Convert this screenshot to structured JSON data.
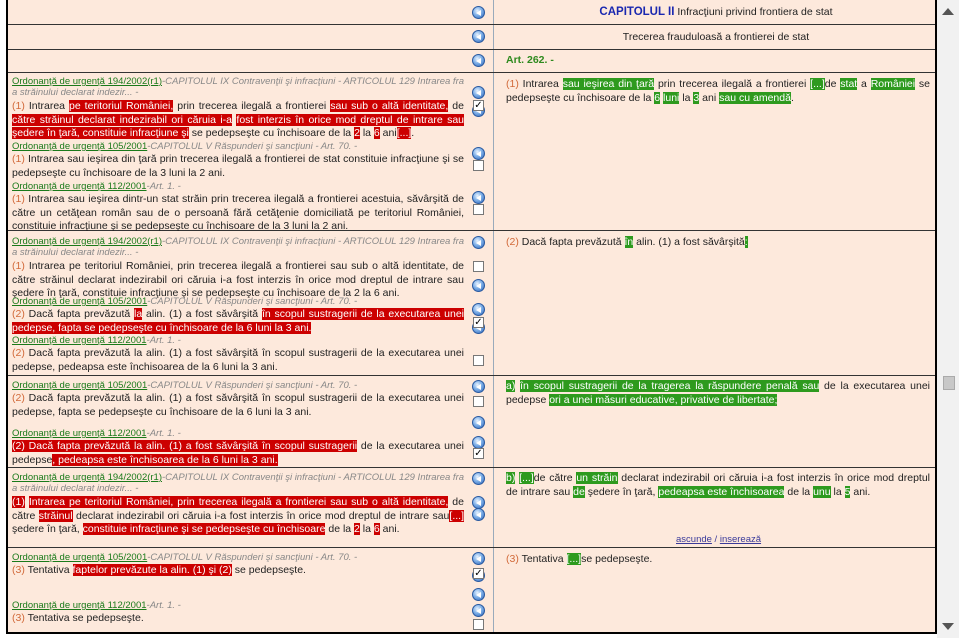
{
  "rows": [
    {
      "heading": {
        "cap": "CAPITOLUL II",
        "rest": " Infracţiuni privind frontiera de stat"
      }
    },
    {
      "heading": "Trecerea frauduloasă a frontierei de stat"
    },
    {
      "article": "Art. 262. -"
    },
    {
      "blocks": [
        {
          "link": "Ordonanţă de urgenţă 194/2002(r1)",
          "tail": "-CAPITOLUL IX Contravenţii şi infracţiuni - ARTICOLUL 129 Intrarea frauduloasă",
          "tail2": "a străinului declarat indezir... -",
          "parts": [
            {
              "t": "(1)",
              "c": "num"
            },
            {
              "t": " Intrarea "
            },
            {
              "t": "pe teritoriul României,",
              "c": "red"
            },
            {
              "t": " prin trecerea ilegală a frontierei "
            },
            {
              "t": "sau sub o altă identitate,",
              "c": "red"
            },
            {
              "t": " de "
            },
            {
              "t": "către străinul declarat indezirabil ori căruia i-a",
              "c": "red"
            },
            {
              "t": " "
            },
            {
              "t": "fost interzis în orice mod dreptul de intrare sau şedere în ţară, constituie infracţiune şi",
              "c": "red"
            },
            {
              "t": " se pedepseşte cu închisoare de la "
            },
            {
              "t": "2",
              "c": "red"
            },
            {
              "t": " la "
            },
            {
              "t": "6",
              "c": "red"
            },
            {
              "t": " ani"
            },
            {
              "t": "[...]",
              "c": "red"
            },
            {
              "t": "."
            }
          ]
        },
        {
          "link": "Ordonanţă de urgenţă 105/2001",
          "tail": "-CAPITOLUL V Răspunderi şi sancţiuni - Art. 70. -",
          "parts": [
            {
              "t": "(1)",
              "c": "num"
            },
            {
              "t": " Intrarea sau ieşirea din ţară prin trecerea ilegală a frontierei de stat constituie infracţiune şi se pedepseşte cu închisoare de la 3 luni la 2 ani."
            }
          ]
        },
        {
          "link": "Ordonanţă de urgenţă 112/2001",
          "tail": "-Art. 1. -",
          "parts": [
            {
              "t": "(1)",
              "c": "num"
            },
            {
              "t": " Intrarea sau ieşirea dintr-un stat străin prin trecerea ilegală a frontierei acestuia, săvârşită de către un cetăţean român sau de o persoană fără cetăţenie domiciliată pe teritoriul României, constituie infracţiune şi se pedepseşte cu închisoare de la 3 luni la 2 ani."
            }
          ]
        }
      ],
      "right": [
        {
          "t": "(1)",
          "c": "num"
        },
        {
          "t": " Intrarea "
        },
        {
          "t": "sau ieşirea din ţară",
          "c": "grn"
        },
        {
          "t": " prin trecerea ilegală a frontierei "
        },
        {
          "t": "[...]",
          "c": "grn"
        },
        {
          "t": "de "
        },
        {
          "t": "stat",
          "c": "grn"
        },
        {
          "t": " a "
        },
        {
          "t": "României",
          "c": "grn"
        },
        {
          "t": " se pedepseşte cu închisoare de la "
        },
        {
          "t": "6",
          "c": "grn"
        },
        {
          "t": " "
        },
        {
          "t": "luni",
          "c": "grn"
        },
        {
          "t": " la "
        },
        {
          "t": "3",
          "c": "grn"
        },
        {
          "t": " ani "
        },
        {
          "t": "sau cu amendă",
          "c": "grn"
        },
        {
          "t": "."
        }
      ]
    },
    {
      "blocks": [
        {
          "link": "Ordonanţă de urgenţă 194/2002(r1)",
          "tail": "-CAPITOLUL IX Contravenţii şi infracţiuni - ARTICOLUL 129 Intrarea frauduloasă",
          "tail2": "a străinului declarat indezir... -",
          "parts": [
            {
              "t": "(1)",
              "c": "num"
            },
            {
              "t": " Intrarea pe teritoriul României, prin trecerea ilegală a frontierei sau sub o altă identitate, de către străinul declarat indezirabil ori căruia i-a fost interzis în orice mod dreptul de intrare sau şedere în ţară, constituie infracţiune şi se pedepseşte cu închisoare de la 2 la 6 ani."
            }
          ]
        },
        {
          "link": "Ordonanţă de urgenţă 105/2001",
          "tail": "-CAPITOLUL V Răspunderi şi sancţiuni - Art. 70. -",
          "parts": [
            {
              "t": "(2)",
              "c": "num"
            },
            {
              "t": " Dacă fapta prevăzută "
            },
            {
              "t": "la",
              "c": "red"
            },
            {
              "t": " alin. (1) a fost săvârşită "
            },
            {
              "t": "în scopul sustragerii de la executarea unei pedepse, fapta se pedepseşte cu închisoare de la 6 luni la 3 ani.",
              "c": "red"
            }
          ]
        },
        {
          "link": "Ordonanţă de urgenţă 112/2001",
          "tail": "-Art. 1. -",
          "parts": [
            {
              "t": "(2)",
              "c": "num"
            },
            {
              "t": " Dacă fapta prevăzută la alin. (1) a fost săvârşită în scopul sustragerii de la executarea unei pedepse, pedeapsa este închisoarea de la 6 luni la 3 ani."
            }
          ]
        }
      ],
      "right": [
        {
          "t": "(2)",
          "c": "num"
        },
        {
          "t": " Dacă fapta prevăzută "
        },
        {
          "t": "în",
          "c": "grn"
        },
        {
          "t": " alin. (1) a fost săvârşită"
        },
        {
          "t": ":",
          "c": "grn"
        }
      ]
    },
    {
      "blocks": [
        {
          "link": "Ordonanţă de urgenţă 105/2001",
          "tail": "-CAPITOLUL V Răspunderi şi sancţiuni - Art. 70. -",
          "parts": [
            {
              "t": "(2)",
              "c": "num"
            },
            {
              "t": " Dacă fapta prevăzută la alin. (1) a fost săvârşită în scopul sustragerii de la executarea unei pedepse, fapta se pedepseşte cu închisoare de la 6 luni la 3 ani."
            }
          ]
        },
        {
          "link": "Ordonanţă de urgenţă 112/2001",
          "tail": "-Art. 1. -",
          "parts": [
            {
              "t": "(2)",
              "c": "red"
            },
            {
              "t": " Dacă fapta prevăzută la alin. (1) a fost săvârşită în scopul sustragerii",
              "c": "red"
            },
            {
              "t": " de la executarea unei pedepse"
            },
            {
              "t": ", pedeapsa este închisoarea de la 6 luni la 3 ani.",
              "c": "red"
            }
          ]
        }
      ],
      "right": [
        {
          "t": "a)",
          "c": "grn"
        },
        {
          "t": " "
        },
        {
          "t": "în scopul sustragerii de la tragerea la răspundere penală sau",
          "c": "grn"
        },
        {
          "t": " de la executarea unei pedepse "
        },
        {
          "t": "ori a unei măsuri educative, privative de libertate;",
          "c": "grn"
        }
      ]
    },
    {
      "blocks": [
        {
          "link": "Ordonanţă de urgenţă 194/2002(r1)",
          "tail": "-CAPITOLUL IX Contravenţii şi infracţiuni - ARTICOLUL 129 Intrarea frauduloasă",
          "tail2": "a străinului declarat indezir... -",
          "parts": [
            {
              "t": "(1)",
              "c": "red"
            },
            {
              "t": " "
            },
            {
              "t": "Intrarea pe teritoriul României, prin trecerea ilegală a frontierei sau sub o altă identitate,",
              "c": "red"
            },
            {
              "t": " de către "
            },
            {
              "t": "străinul",
              "c": "red"
            },
            {
              "t": " declarat indezirabil ori căruia i-a fost interzis în orice mod dreptul de intrare sau"
            },
            {
              "t": "[...]",
              "c": "red"
            },
            {
              "t": " şedere în ţară, "
            },
            {
              "t": "constituie infracţiune şi se pedepseşte cu închisoare",
              "c": "red"
            },
            {
              "t": " de la "
            },
            {
              "t": "2",
              "c": "red"
            },
            {
              "t": " la "
            },
            {
              "t": "6",
              "c": "red"
            },
            {
              "t": " ani."
            }
          ]
        }
      ],
      "right": [
        {
          "t": "b)",
          "c": "grn"
        },
        {
          "t": " "
        },
        {
          "t": "[...]",
          "c": "grn"
        },
        {
          "t": "de către "
        },
        {
          "t": "un străin",
          "c": "grn"
        },
        {
          "t": " declarat indezirabil ori căruia i-a fost interzis în orice mod dreptul de intrare sau "
        },
        {
          "t": "de",
          "c": "grn"
        },
        {
          "t": " şedere în ţară, "
        },
        {
          "t": "pedeapsa este închisoarea",
          "c": "grn"
        },
        {
          "t": " de la "
        },
        {
          "t": "unu",
          "c": "grn"
        },
        {
          "t": " la "
        },
        {
          "t": "5",
          "c": "grn"
        },
        {
          "t": " ani."
        }
      ],
      "links": {
        "a": "ascunde",
        "sep": " / ",
        "b": "inserează"
      }
    },
    {
      "blocks": [
        {
          "link": "Ordonanţă de urgenţă 105/2001",
          "tail": "-CAPITOLUL V Răspunderi şi sancţiuni - Art. 70. -",
          "parts": [
            {
              "t": "(3)",
              "c": "num"
            },
            {
              "t": " Tentativa "
            },
            {
              "t": "faptelor prevăzute la alin. (1) şi (2)",
              "c": "red"
            },
            {
              "t": " se pedepseşte."
            }
          ]
        },
        {
          "link": "Ordonanţă de urgenţă 112/2001",
          "tail": "-Art. 1. -",
          "parts": [
            {
              "t": "(3)",
              "c": "num"
            },
            {
              "t": " Tentativa se pedepseşte."
            }
          ]
        }
      ],
      "right": [
        {
          "t": "(3)",
          "c": "num"
        },
        {
          "t": " Tentativa "
        },
        {
          "t": "[...]",
          "c": "grn"
        },
        {
          "t": "se pedepseşte."
        }
      ]
    }
  ],
  "checkboxes": [
    true,
    false,
    false,
    false,
    true,
    false,
    false,
    true,
    false,
    true,
    false
  ]
}
